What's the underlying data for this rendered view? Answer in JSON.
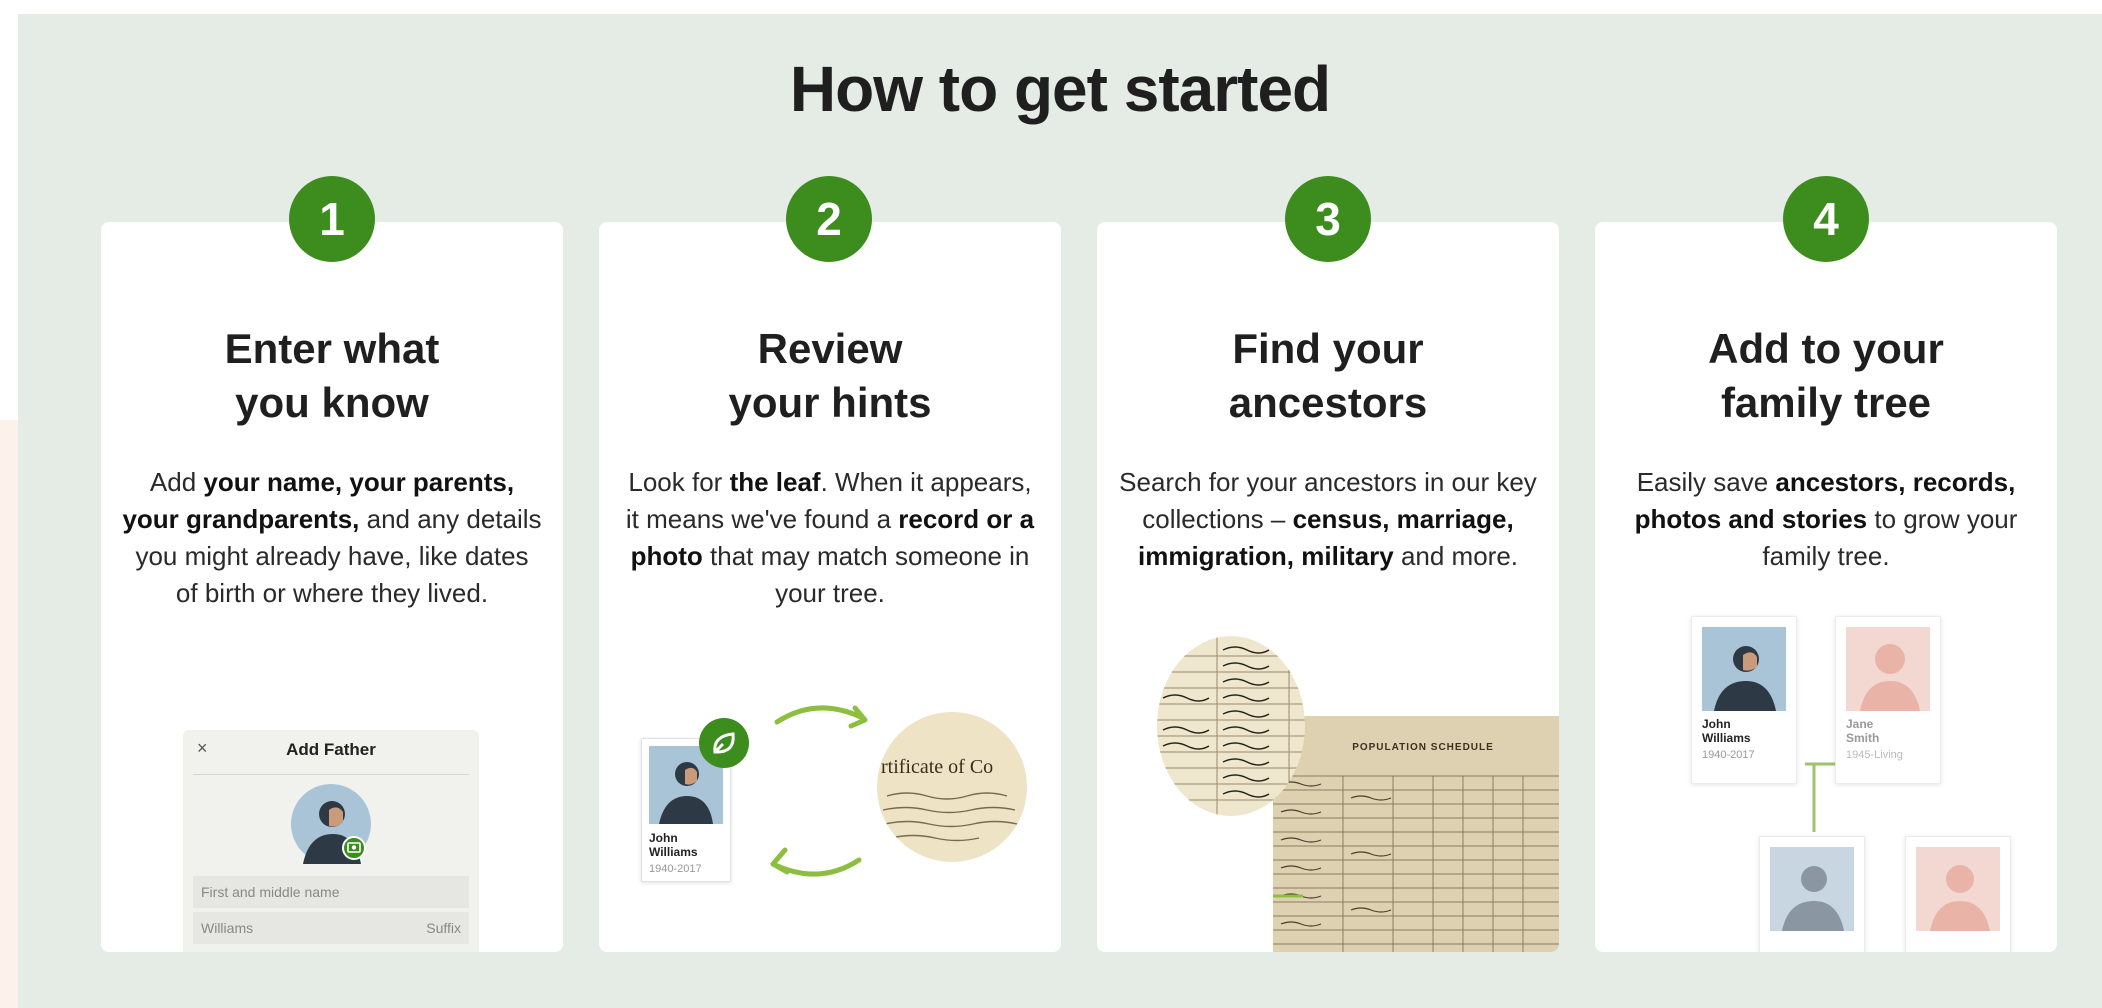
{
  "page": {
    "title": "How to get started",
    "accent_color": "#3c8d1e",
    "background_color": "#e4ece5"
  },
  "steps": [
    {
      "number": "1",
      "title_line1": "Enter what",
      "title_line2": "you know",
      "desc": [
        {
          "t": "Add ",
          "b": false
        },
        {
          "t": "your name, your parents, your grandparents,",
          "b": true
        },
        {
          "t": " and any details you might already have, like dates of birth or where they lived.",
          "b": false
        }
      ],
      "form": {
        "close_icon": "×",
        "title": "Add Father",
        "first_middle_placeholder": "First and middle name",
        "last_name_value": "Williams",
        "suffix_placeholder": "Suffix"
      }
    },
    {
      "number": "2",
      "title_line1": "Review",
      "title_line2": "your hints",
      "desc": [
        {
          "t": "Look for ",
          "b": false
        },
        {
          "t": "the leaf",
          "b": true
        },
        {
          "t": ". When it appears, it means we've found a ",
          "b": false
        },
        {
          "t": "record or a photo",
          "b": true
        },
        {
          "t": " that may match someone in your tree.",
          "b": false
        }
      ],
      "person": {
        "first": "John",
        "last": "Williams",
        "years": "1940-2017"
      },
      "document_text": "rtificate of Co"
    },
    {
      "number": "3",
      "title_line1": "Find your",
      "title_line2": "ancestors",
      "desc": [
        {
          "t": "Search for your ancestors in our key collections – ",
          "b": false
        },
        {
          "t": "census, marriage, immigration, military",
          "b": true
        },
        {
          "t": " and more.",
          "b": false
        }
      ],
      "census_heading": "POPULATION SCHEDULE"
    },
    {
      "number": "4",
      "title_line1": "Add to your",
      "title_line2": "family tree",
      "desc": [
        {
          "t": "Easily save ",
          "b": false
        },
        {
          "t": "ancestors, records, photos and stories",
          "b": true
        },
        {
          "t": " to grow your family tree.",
          "b": false
        }
      ],
      "tree": {
        "person1": {
          "first": "John",
          "last": "Williams",
          "years": "1940-2017"
        },
        "person2": {
          "first": "Jane",
          "last": "Smith",
          "years": "1945-Living"
        }
      }
    }
  ]
}
